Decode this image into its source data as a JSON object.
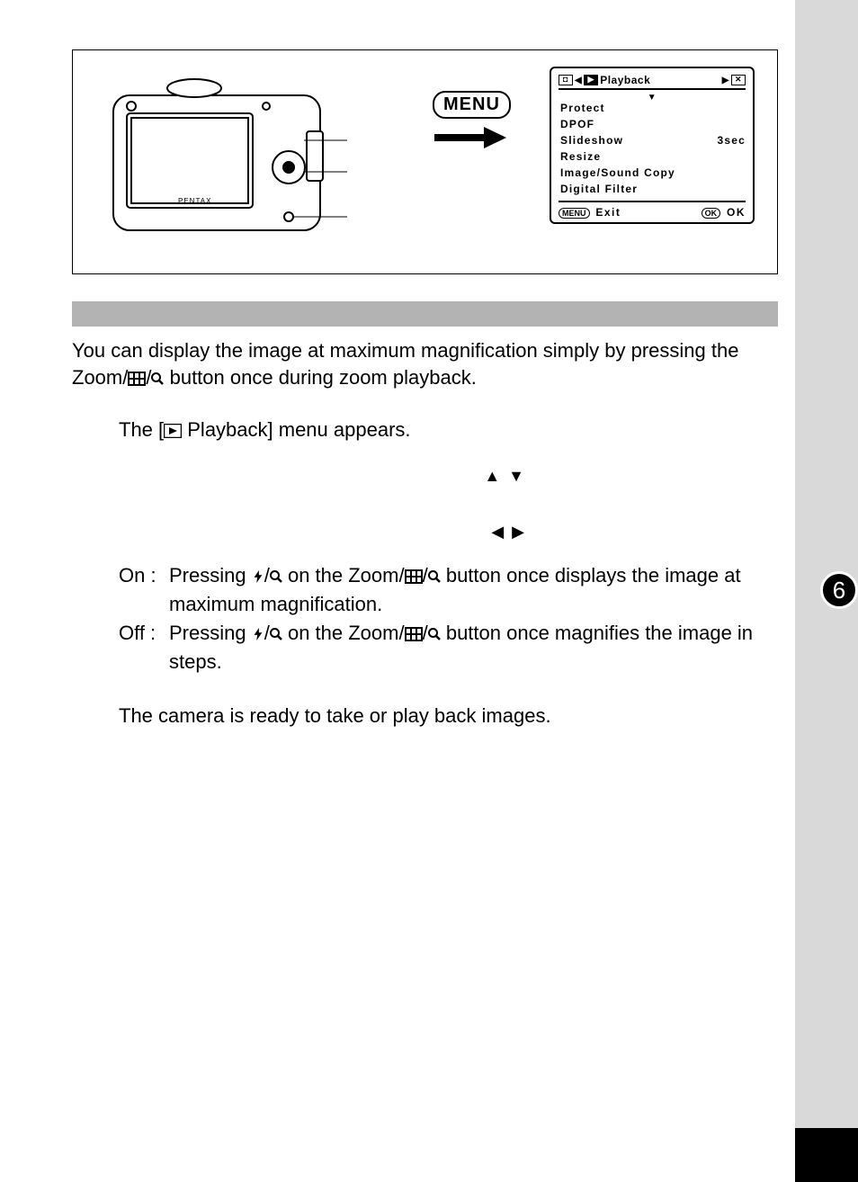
{
  "figure": {
    "menu_label": "MENU",
    "lcd": {
      "tab_playback": "Playback",
      "items": [
        {
          "label": "Protect",
          "value": ""
        },
        {
          "label": "DPOF",
          "value": ""
        },
        {
          "label": "Slideshow",
          "value": "3sec"
        },
        {
          "label": "Resize",
          "value": ""
        },
        {
          "label": "Image/Sound Copy",
          "value": ""
        },
        {
          "label": "Digital Filter",
          "value": ""
        }
      ],
      "footer_menu": "MENU",
      "footer_exit": "Exit",
      "footer_ok_badge": "OK",
      "footer_ok": "OK"
    }
  },
  "intro_part1": "You can display the image at maximum magnification simply by pressing the Zoom/",
  "intro_part2": " button once during zoom playback.",
  "step1_body": "The [",
  "step1_body2": " Playback] menu appears.",
  "on_label": "On :",
  "on_text_a": "Pressing ",
  "on_text_b": " on the Zoom/",
  "on_text_c": " button once displays the image at maximum magnification.",
  "off_label": "Off :",
  "off_text_a": "Pressing ",
  "off_text_b": " on the Zoom/",
  "off_text_c": " button once magnifies the image in steps.",
  "step4_body": "The camera is ready to take or play back images.",
  "page_number": "6"
}
